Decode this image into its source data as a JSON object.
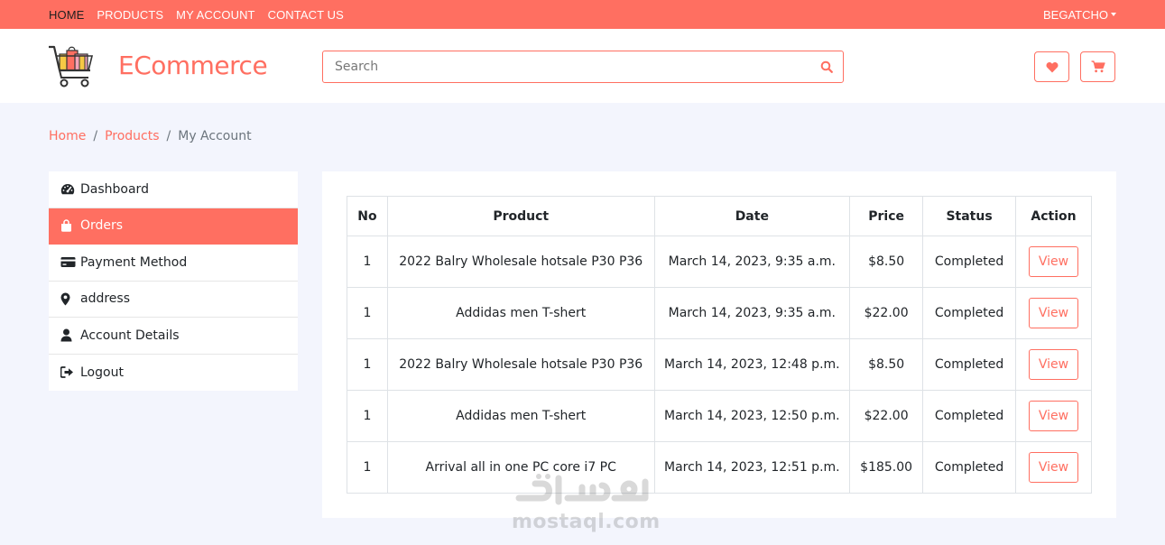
{
  "topbar": {
    "nav": [
      {
        "label": "HOME",
        "active": true
      },
      {
        "label": "PRODUCTS",
        "active": false
      },
      {
        "label": "MY ACCOUNT",
        "active": false
      },
      {
        "label": "CONTACT US",
        "active": false
      }
    ],
    "user": "BEGATCHO"
  },
  "header": {
    "brand": "ECommerce",
    "search_placeholder": "Search",
    "icons": {
      "logo": "shopping-cart-logo",
      "search": "search-icon",
      "wishlist": "heart-icon",
      "cart": "cart-icon"
    }
  },
  "breadcrumb": {
    "items": [
      "Home",
      "Products"
    ],
    "current": "My Account"
  },
  "sidebar": {
    "items": [
      {
        "label": "Dashboard",
        "icon": "tachometer-icon",
        "active": false
      },
      {
        "label": "Orders",
        "icon": "shopping-bag-icon",
        "active": true
      },
      {
        "label": "Payment Method",
        "icon": "credit-card-icon",
        "active": false
      },
      {
        "label": "address",
        "icon": "map-marker-icon",
        "active": false
      },
      {
        "label": "Account Details",
        "icon": "user-icon",
        "active": false
      },
      {
        "label": "Logout",
        "icon": "sign-out-icon",
        "active": false
      }
    ]
  },
  "orders": {
    "headers": [
      "No",
      "Product",
      "Date",
      "Price",
      "Status",
      "Action"
    ],
    "rows": [
      {
        "no": "1",
        "product": "2022 Balry Wholesale hotsale P30 P36",
        "date": "March 14, 2023, 9:35 a.m.",
        "price": "$8.50",
        "status": "Completed",
        "action": "View"
      },
      {
        "no": "1",
        "product": "Addidas men T-shert",
        "date": "March 14, 2023, 9:35 a.m.",
        "price": "$22.00",
        "status": "Completed",
        "action": "View"
      },
      {
        "no": "1",
        "product": "2022 Balry Wholesale hotsale P30 P36",
        "date": "March 14, 2023, 12:48 p.m.",
        "price": "$8.50",
        "status": "Completed",
        "action": "View"
      },
      {
        "no": "1",
        "product": "Addidas men T-shert",
        "date": "March 14, 2023, 12:50 p.m.",
        "price": "$22.00",
        "status": "Completed",
        "action": "View"
      },
      {
        "no": "1",
        "product": "Arrival all in one PC core i7 PC",
        "date": "March 14, 2023, 12:51 p.m.",
        "price": "$185.00",
        "status": "Completed",
        "action": "View"
      }
    ]
  },
  "watermark": {
    "text": "mostaql.com",
    "script": "مستقل"
  },
  "colors": {
    "accent": "#ff6f61",
    "background": "#f3f5fd",
    "card": "#ffffff",
    "text": "#212529",
    "muted": "#6c757d"
  }
}
